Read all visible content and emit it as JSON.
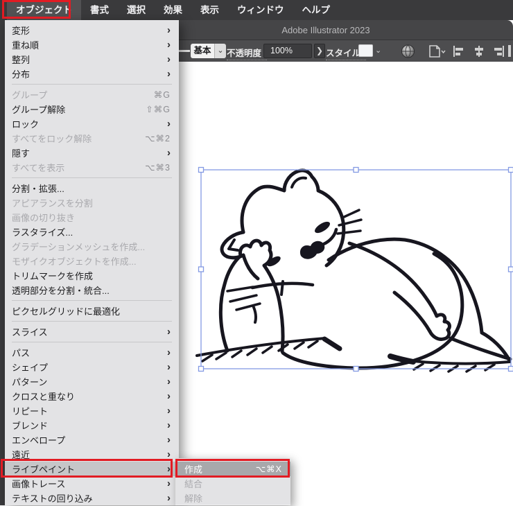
{
  "menubar": {
    "items": [
      {
        "label": "オブジェクト",
        "active": true
      },
      {
        "label": "書式"
      },
      {
        "label": "選択"
      },
      {
        "label": "効果"
      },
      {
        "label": "表示"
      },
      {
        "label": "ウィンドウ"
      },
      {
        "label": "ヘルプ"
      }
    ]
  },
  "window": {
    "title": "Adobe Illustrator 2023"
  },
  "toolbar": {
    "stroke_style_label": "基本",
    "opacity_label": "不透明度 :",
    "opacity_value": "100%",
    "opacity_expand_glyph": "❯",
    "style_label": "スタイル :",
    "dropdown_glyph": "⌄",
    "icons": [
      "stroke-preview-line",
      "recolor-sphere-icon",
      "document-setup-icon",
      "align-left-icon",
      "align-center-icon",
      "align-right-icon"
    ]
  },
  "object_menu": {
    "arrow_glyph": "›",
    "sections": [
      {
        "items": [
          {
            "label": "変形",
            "submenu": true
          },
          {
            "label": "重ね順",
            "submenu": true
          },
          {
            "label": "整列",
            "submenu": true
          },
          {
            "label": "分布",
            "submenu": true
          }
        ]
      },
      {
        "items": [
          {
            "label": "グループ",
            "shortcut": "⌘G",
            "disabled": true
          },
          {
            "label": "グループ解除",
            "shortcut": "⇧⌘G"
          },
          {
            "label": "ロック",
            "submenu": true
          },
          {
            "label": "すべてをロック解除",
            "shortcut": "⌥⌘2",
            "disabled": true
          },
          {
            "label": "隠す",
            "submenu": true
          },
          {
            "label": "すべてを表示",
            "shortcut": "⌥⌘3",
            "disabled": true
          }
        ]
      },
      {
        "items": [
          {
            "label": "分割・拡張..."
          },
          {
            "label": "アピアランスを分割",
            "disabled": true
          },
          {
            "label": "画像の切り抜き",
            "disabled": true
          },
          {
            "label": "ラスタライズ..."
          },
          {
            "label": "グラデーションメッシュを作成...",
            "disabled": true
          },
          {
            "label": "モザイクオブジェクトを作成...",
            "disabled": true
          },
          {
            "label": "トリムマークを作成"
          },
          {
            "label": "透明部分を分割・統合..."
          }
        ]
      },
      {
        "items": [
          {
            "label": "ピクセルグリッドに最適化"
          }
        ]
      },
      {
        "items": [
          {
            "label": "スライス",
            "submenu": true
          }
        ]
      },
      {
        "items": [
          {
            "label": "パス",
            "submenu": true
          },
          {
            "label": "シェイプ",
            "submenu": true
          },
          {
            "label": "パターン",
            "submenu": true
          },
          {
            "label": "クロスと重なり",
            "submenu": true
          },
          {
            "label": "リピート",
            "submenu": true
          },
          {
            "label": "ブレンド",
            "submenu": true
          },
          {
            "label": "エンベロープ",
            "submenu": true
          },
          {
            "label": "遠近",
            "submenu": true
          },
          {
            "label": "ライブペイント",
            "submenu": true,
            "selected": true
          },
          {
            "label": "画像トレース",
            "submenu": true
          },
          {
            "label": "テキストの回り込み",
            "submenu": true
          }
        ]
      }
    ]
  },
  "live_paint_submenu": {
    "items": [
      {
        "label": "作成",
        "shortcut": "⌥⌘X",
        "selected": true
      },
      {
        "label": "結合",
        "disabled": true
      },
      {
        "label": "解除",
        "disabled": true
      }
    ]
  },
  "colors": {
    "annotation_red": "#e21b23",
    "selection_blue": "#8399e3",
    "artwork_ink": "#17161f",
    "menu_bg": "#e3e3e5"
  }
}
